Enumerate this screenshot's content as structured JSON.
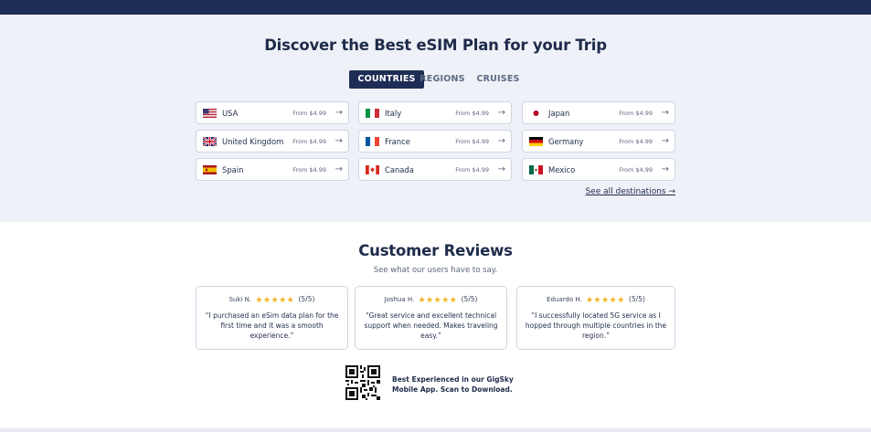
{
  "destinations": {
    "title": "Discover the Best eSIM Plan for your Trip",
    "tabs": [
      "COUNTRIES",
      "REGIONS",
      "CRUISES"
    ],
    "active_tab": "COUNTRIES",
    "cards": [
      {
        "name": "USA",
        "price": "From $4.99",
        "flag_icon": "us-flag-icon"
      },
      {
        "name": "Italy",
        "price": "From $4.99",
        "flag_icon": "italy-flag-icon"
      },
      {
        "name": "Japan",
        "price": "From $4.99",
        "flag_icon": "japan-flag-icon"
      },
      {
        "name": "United Kingdom",
        "price": "From $4.99",
        "flag_icon": "uk-flag-icon"
      },
      {
        "name": "France",
        "price": "From $4.99",
        "flag_icon": "france-flag-icon"
      },
      {
        "name": "Germany",
        "price": "From $4.99",
        "flag_icon": "germany-flag-icon"
      },
      {
        "name": "Spain",
        "price": "From $4.99",
        "flag_icon": "spain-flag-icon"
      },
      {
        "name": "Canada",
        "price": "From $4.99",
        "flag_icon": "canada-flag-icon"
      },
      {
        "name": "Mexico",
        "price": "From $4.99",
        "flag_icon": "mexico-flag-icon"
      }
    ],
    "arrow": "→",
    "see_all": "See all destinations →"
  },
  "reviews": {
    "title": "Customer Reviews",
    "subtitle": "See what our users have to say.",
    "items": [
      {
        "author": "Suki N.",
        "stars": "★★★★★",
        "rating": "(5/5)",
        "text": "“I purchased an eSim data plan for the first time and it was a smooth experience.”"
      },
      {
        "author": "Joshua H.",
        "stars": "★★★★★",
        "rating": "(5/5)",
        "text": "“Great service and excellent technical support when needed. Makes traveling easy.”"
      },
      {
        "author": "Eduardo H.",
        "stars": "★★★★★",
        "rating": "(5/5)",
        "text": "“I successfully located 5G service as I hopped through multiple countries in the region.”"
      }
    ]
  },
  "app_promo": {
    "text": "Best Experienced in our GigSky Mobile App. Scan to Download.",
    "qr_icon": "qr-code-icon"
  },
  "colors": {
    "brand_navy": "#1e2d55",
    "star": "#f2b320",
    "section_bg": "#eef1f7"
  }
}
